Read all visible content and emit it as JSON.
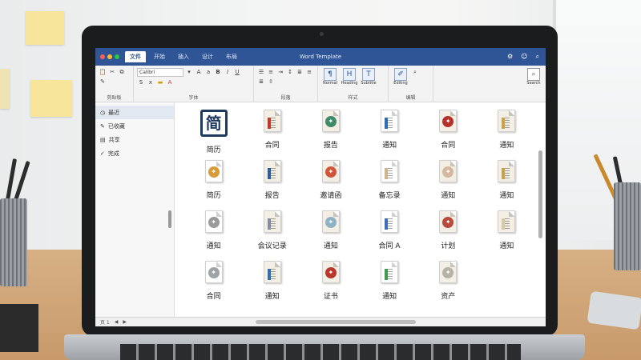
{
  "window": {
    "title": "Word Template"
  },
  "titlebar": {
    "tabs": [
      {
        "label": "文件"
      },
      {
        "label": "开始"
      },
      {
        "label": "插入"
      },
      {
        "label": "设计"
      },
      {
        "label": "布局"
      }
    ]
  },
  "ribbon": {
    "font_name": "Calibri",
    "groups": [
      {
        "label": "剪贴板"
      },
      {
        "label": "字体"
      },
      {
        "label": "段落"
      },
      {
        "label": "样式"
      },
      {
        "label": "编辑"
      }
    ],
    "buttons": [
      {
        "label": "Normal"
      },
      {
        "label": "Heading"
      },
      {
        "label": "Subtitle"
      },
      {
        "label": "Editing"
      }
    ],
    "search_label": "Search"
  },
  "sidebar": {
    "items": [
      {
        "label": "最近"
      },
      {
        "label": "已收藏"
      },
      {
        "label": "共享"
      },
      {
        "label": "完成"
      }
    ]
  },
  "templates": [
    {
      "label": "简历",
      "icon": "resume-icon",
      "color": "#1f3a5f"
    },
    {
      "label": "合同",
      "icon": "contract-icon",
      "color": "#c0392b"
    },
    {
      "label": "报告",
      "icon": "report-icon",
      "color": "#3d8b6b"
    },
    {
      "label": "通知",
      "icon": "notice-icon",
      "color": "#2e6db3"
    },
    {
      "label": "合同",
      "icon": "contract-icon",
      "color": "#b5322b"
    },
    {
      "label": "通知",
      "icon": "notice-icon",
      "color": "#c8a34a"
    },
    {
      "label": "简历",
      "icon": "resume-icon",
      "color": "#d89b3c"
    },
    {
      "label": "报告",
      "icon": "report-icon",
      "color": "#2e5d9e"
    },
    {
      "label": "邀请函",
      "icon": "invite-icon",
      "color": "#d1553a"
    },
    {
      "label": "备忘录",
      "icon": "memo-icon",
      "color": "#cdb78a"
    },
    {
      "label": "通知",
      "icon": "notice-icon",
      "color": "#d4b8a0"
    },
    {
      "label": "通知",
      "icon": "notice-icon",
      "color": "#c6a34a"
    },
    {
      "label": "通知",
      "icon": "notice-icon",
      "color": "#9a9a9a"
    },
    {
      "label": "会议记录",
      "icon": "minutes-icon",
      "color": "#7f8ea3"
    },
    {
      "label": "通知",
      "icon": "notice-icon",
      "color": "#8fb3c4"
    },
    {
      "label": "合同 A",
      "icon": "contract-icon",
      "color": "#3c6fb8"
    },
    {
      "label": "计划",
      "icon": "plan-icon",
      "color": "#b84a3c"
    },
    {
      "label": "通知",
      "icon": "notice-icon",
      "color": "#d8c9a8"
    },
    {
      "label": "合同",
      "icon": "contract-icon",
      "color": "#9ea3a8"
    },
    {
      "label": "通知",
      "icon": "notice-icon",
      "color": "#2f6fb0"
    },
    {
      "label": "证书",
      "icon": "certificate-icon",
      "color": "#b8362b"
    },
    {
      "label": "通知",
      "icon": "notice-icon",
      "color": "#3f9b4e"
    },
    {
      "label": "资产",
      "icon": "asset-icon",
      "color": "#b7b2a8"
    }
  ],
  "statusbar": {
    "page": "页 1"
  }
}
